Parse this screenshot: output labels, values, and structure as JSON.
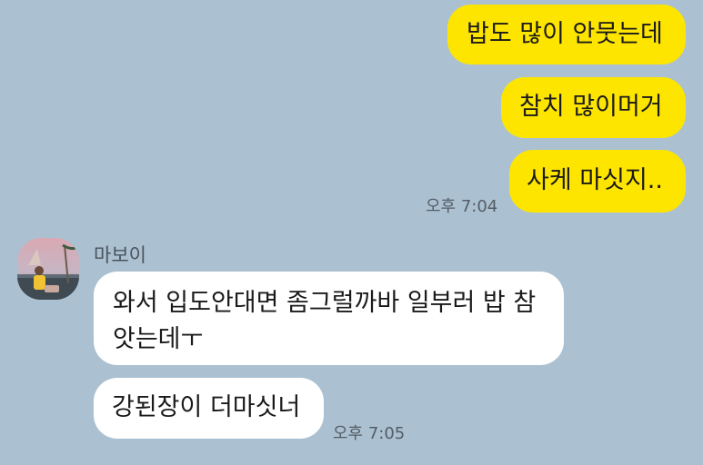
{
  "chat": {
    "outgoing": [
      {
        "text": "밥도 많이 안뭇는데"
      },
      {
        "text": "참치 많이머거"
      },
      {
        "text": "사케 마싯지.."
      }
    ],
    "outgoing_time": "오후 7:04",
    "sender": {
      "name": "마보이",
      "avatar_icon": "profile-photo"
    },
    "incoming": [
      {
        "line1": "와서 입도안대면 좀그럴까바 일부러 밥 참",
        "line2": "앗는데ㅜ"
      },
      {
        "text": "강된장이 더마싯너"
      }
    ],
    "incoming_time": "오후 7:05"
  },
  "colors": {
    "background": "#abc1d1",
    "outgoing_bubble": "#fee500",
    "incoming_bubble": "#ffffff"
  }
}
